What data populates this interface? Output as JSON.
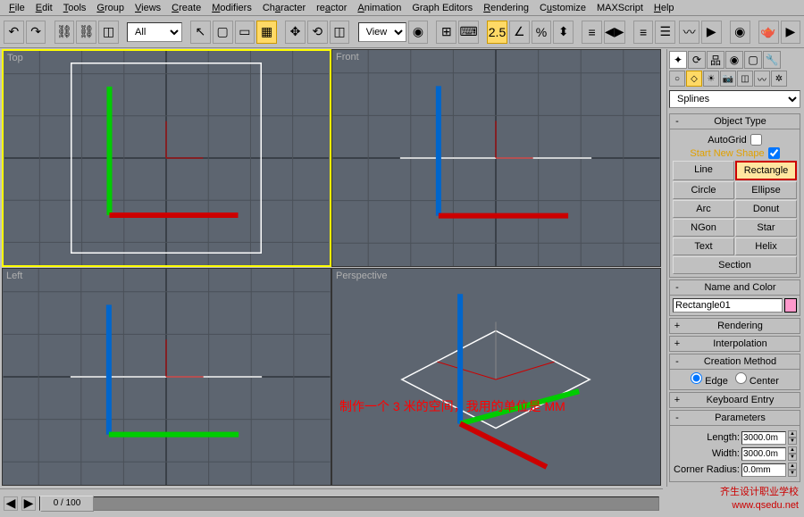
{
  "menu": [
    "File",
    "Edit",
    "Tools",
    "Group",
    "Views",
    "Create",
    "Modifiers",
    "Character",
    "reactor",
    "Animation",
    "Graph Editors",
    "Rendering",
    "Customize",
    "MAXScript",
    "Help"
  ],
  "toolbar": {
    "selection_set": "All",
    "view_mode": "View",
    "snap_value": "2.5"
  },
  "viewports": {
    "top": "Top",
    "front": "Front",
    "left": "Left",
    "perspective": "Perspective"
  },
  "sidepanel": {
    "category": "Splines",
    "object_type": {
      "header": "Object Type",
      "autogrid": "AutoGrid",
      "start_new_shape": "Start New Shape",
      "buttons": [
        "Line",
        "Rectangle",
        "Circle",
        "Ellipse",
        "Arc",
        "Donut",
        "NGon",
        "Star",
        "Text",
        "Helix",
        "Section"
      ]
    },
    "name_color": {
      "header": "Name and Color",
      "value": "Rectangle01"
    },
    "rendering": "Rendering",
    "interpolation": "Interpolation",
    "creation_method": {
      "header": "Creation Method",
      "edge": "Edge",
      "center": "Center"
    },
    "keyboard_entry": "Keyboard Entry",
    "parameters": {
      "header": "Parameters",
      "length_label": "Length:",
      "length_value": "3000.0m",
      "width_label": "Width:",
      "width_value": "3000.0m",
      "corner_label": "Corner Radius:",
      "corner_value": "0.0mm"
    }
  },
  "timeline": {
    "frame": "0 / 100"
  },
  "annotation": "制作一个 3 米的空间，我用的单位是 MM",
  "watermark": {
    "line1": "齐生设计职业学校",
    "line2": "www.qsedu.net"
  }
}
